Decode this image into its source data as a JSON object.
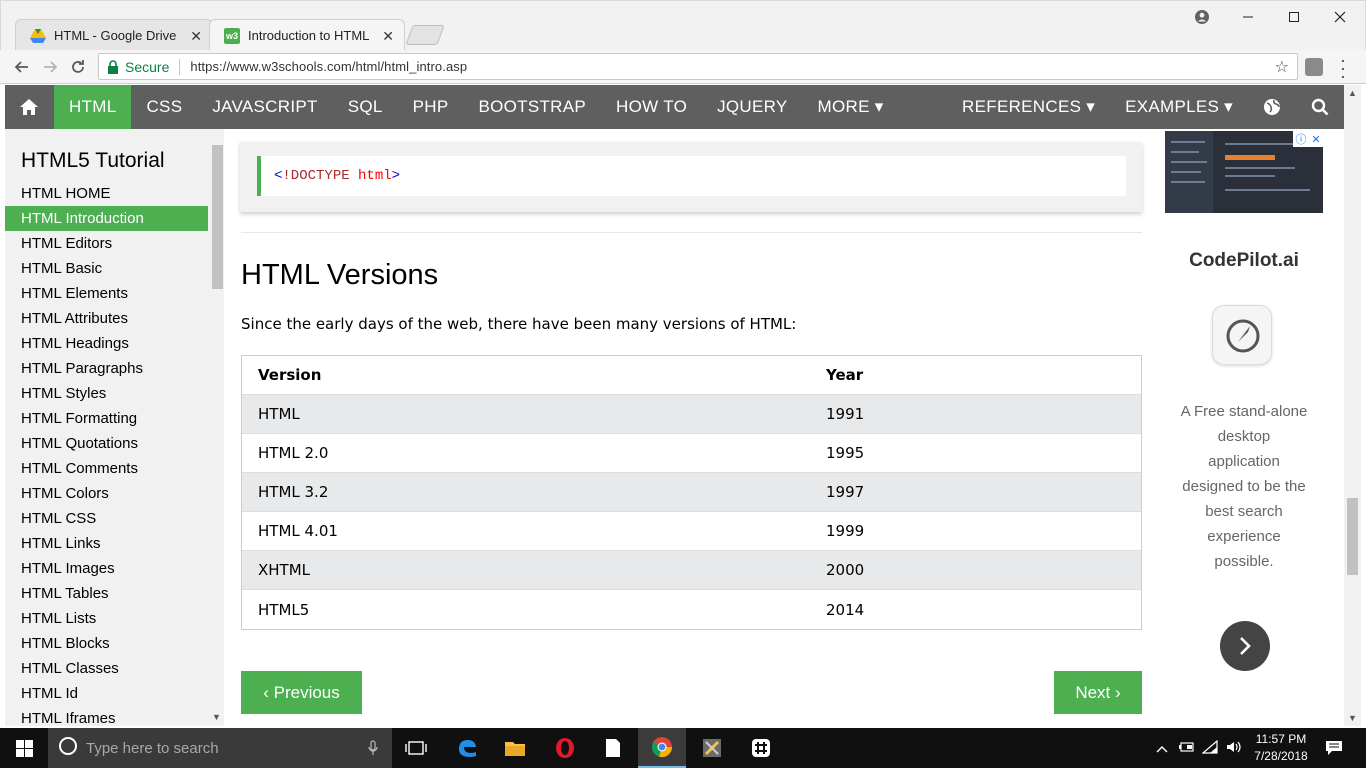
{
  "browser": {
    "tabs": [
      {
        "title": "HTML - Google Drive",
        "active": false
      },
      {
        "title": "Introduction to HTML",
        "active": true
      }
    ],
    "secure_label": "Secure",
    "url": "https://www.w3schools.com/html/html_intro.asp"
  },
  "topnav": {
    "items": [
      "HTML",
      "CSS",
      "JAVASCRIPT",
      "SQL",
      "PHP",
      "BOOTSTRAP",
      "HOW TO",
      "JQUERY",
      "MORE ▾"
    ],
    "right_items": [
      "REFERENCES ▾",
      "EXAMPLES ▾"
    ],
    "active_index": 0,
    "accent": "#4caf50",
    "bar_color": "#5f5f5f"
  },
  "sidebar": {
    "title": "HTML5 Tutorial",
    "active_index": 1,
    "items": [
      "HTML HOME",
      "HTML Introduction",
      "HTML Editors",
      "HTML Basic",
      "HTML Elements",
      "HTML Attributes",
      "HTML Headings",
      "HTML Paragraphs",
      "HTML Styles",
      "HTML Formatting",
      "HTML Quotations",
      "HTML Comments",
      "HTML Colors",
      "HTML CSS",
      "HTML Links",
      "HTML Images",
      "HTML Tables",
      "HTML Lists",
      "HTML Blocks",
      "HTML Classes",
      "HTML Id",
      "HTML Iframes"
    ]
  },
  "main": {
    "code": {
      "open": "<",
      "doctype": "!DOCTYPE",
      "attr": "html",
      "close": ">"
    },
    "heading": "HTML Versions",
    "intro": "Since the early days of the web, there have been many versions of HTML:",
    "table": {
      "headers": [
        "Version",
        "Year"
      ],
      "rows": [
        [
          "HTML",
          "1991"
        ],
        [
          "HTML 2.0",
          "1995"
        ],
        [
          "HTML 3.2",
          "1997"
        ],
        [
          "HTML 4.01",
          "1999"
        ],
        [
          "XHTML",
          "2000"
        ],
        [
          "HTML5",
          "2014"
        ]
      ]
    },
    "prev_label": "‹ Previous",
    "next_label": "Next ›"
  },
  "ad": {
    "brand": "CodePilot.ai",
    "description": "A Free stand-alone desktop application designed to be the best search experience possible."
  },
  "taskbar": {
    "search_placeholder": "Type here to search",
    "time": "11:57 PM",
    "date": "7/28/2018"
  }
}
